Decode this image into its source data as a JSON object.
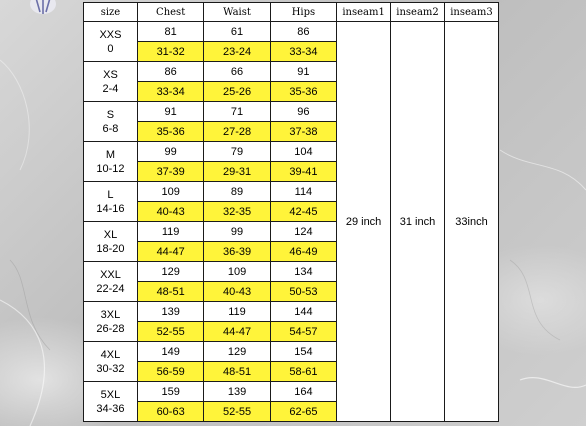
{
  "headers": {
    "size": "size",
    "chest": "Chest",
    "waist": "Waist",
    "hips": "Hips",
    "inseam1": "inseam1",
    "inseam2": "inseam2",
    "inseam3": "inseam3"
  },
  "rows": [
    {
      "name": "XXS",
      "num": "0",
      "cm": [
        "81",
        "61",
        "86"
      ],
      "inch": [
        "31-32",
        "23-24",
        "33-34"
      ]
    },
    {
      "name": "XS",
      "num": "2-4",
      "cm": [
        "86",
        "66",
        "91"
      ],
      "inch": [
        "33-34",
        "25-26",
        "35-36"
      ]
    },
    {
      "name": "S",
      "num": "6-8",
      "cm": [
        "91",
        "71",
        "96"
      ],
      "inch": [
        "35-36",
        "27-28",
        "37-38"
      ]
    },
    {
      "name": "M",
      "num": "10-12",
      "cm": [
        "99",
        "79",
        "104"
      ],
      "inch": [
        "37-39",
        "29-31",
        "39-41"
      ]
    },
    {
      "name": "L",
      "num": "14-16",
      "cm": [
        "109",
        "89",
        "114"
      ],
      "inch": [
        "40-43",
        "32-35",
        "42-45"
      ]
    },
    {
      "name": "XL",
      "num": "18-20",
      "cm": [
        "119",
        "99",
        "124"
      ],
      "inch": [
        "44-47",
        "36-39",
        "46-49"
      ]
    },
    {
      "name": "XXL",
      "num": "22-24",
      "cm": [
        "129",
        "109",
        "134"
      ],
      "inch": [
        "48-51",
        "40-43",
        "50-53"
      ]
    },
    {
      "name": "3XL",
      "num": "26-28",
      "cm": [
        "139",
        "119",
        "144"
      ],
      "inch": [
        "52-55",
        "44-47",
        "54-57"
      ]
    },
    {
      "name": "4XL",
      "num": "30-32",
      "cm": [
        "149",
        "129",
        "154"
      ],
      "inch": [
        "56-59",
        "48-51",
        "58-61"
      ]
    },
    {
      "name": "5XL",
      "num": "34-36",
      "cm": [
        "159",
        "139",
        "164"
      ],
      "inch": [
        "60-63",
        "52-55",
        "62-65"
      ]
    }
  ],
  "inseams": {
    "inseam1": "29 inch",
    "inseam2": "31 inch",
    "inseam3": "33inch"
  },
  "colors": {
    "highlight": "#fff43a",
    "border": "#1a1a1a",
    "background": "#c9c9c9"
  },
  "icons": {
    "corner_logo": "brand-logo-icon"
  }
}
